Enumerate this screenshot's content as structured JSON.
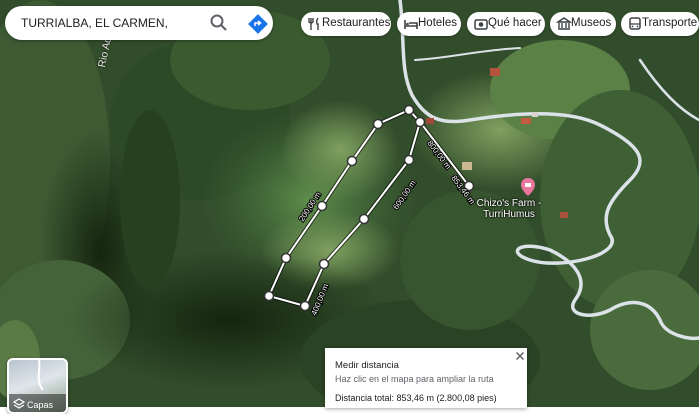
{
  "search": {
    "query": "TURRIALBA, EL CARMEN,"
  },
  "chips": [
    {
      "label": "Restaurantes",
      "icon": "fork-knife-icon"
    },
    {
      "label": "Hoteles",
      "icon": "bed-icon"
    },
    {
      "label": "Qué hacer",
      "icon": "camera-icon"
    },
    {
      "label": "Museos",
      "icon": "museum-icon"
    },
    {
      "label": "Transporte",
      "icon": "bus-icon"
    }
  ],
  "map": {
    "river_label": "Rio Aquiares",
    "poi": {
      "name": "Chizo's Farm - TurriHumus",
      "icon": "pin-icon",
      "color": "#e8769c"
    },
    "segment_labels": [
      "200,00 m",
      "400,00 m",
      "600,00 m",
      "800,00 m",
      "853,46 m"
    ]
  },
  "layers": {
    "label": "Capas",
    "icon": "layers-icon"
  },
  "measure": {
    "title": "Medir distancia",
    "hint": "Haz clic en el mapa para ampliar la ruta",
    "total": "Distancia total: 853,46 m (2.800,08 pies)",
    "close_icon": "close-icon"
  },
  "colors": {
    "accent": "#1a73e8",
    "road": "#dbe2e8"
  }
}
